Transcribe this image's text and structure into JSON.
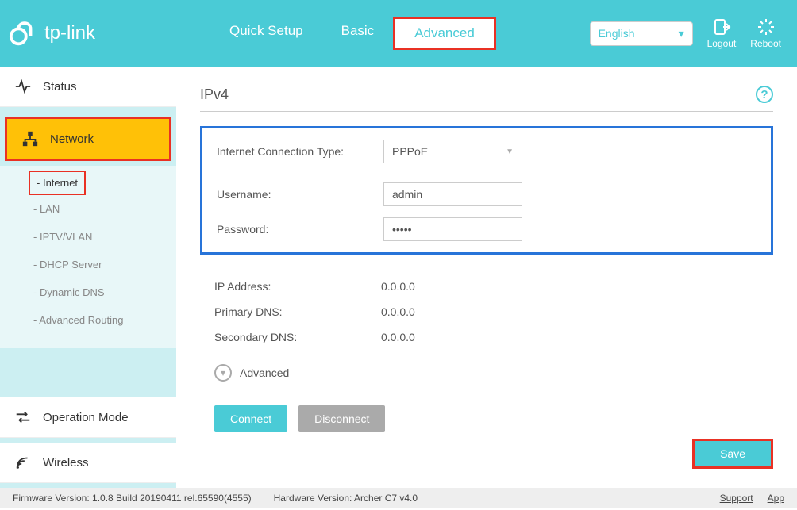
{
  "header": {
    "brand": "tp-link",
    "tabs": {
      "quick_setup": "Quick Setup",
      "basic": "Basic",
      "advanced": "Advanced"
    },
    "language": "English",
    "logout": "Logout",
    "reboot": "Reboot"
  },
  "sidebar": {
    "status": "Status",
    "network": "Network",
    "sub": {
      "internet": "Internet",
      "lan": "LAN",
      "iptv": "IPTV/VLAN",
      "dhcp": "DHCP Server",
      "ddns": "Dynamic DNS",
      "routing": "Advanced Routing"
    },
    "operation_mode": "Operation Mode",
    "wireless": "Wireless"
  },
  "main": {
    "title": "IPv4",
    "labels": {
      "conn_type": "Internet Connection Type:",
      "username": "Username:",
      "password": "Password:",
      "ip": "IP Address:",
      "pdns": "Primary DNS:",
      "sdns": "Secondary DNS:"
    },
    "values": {
      "conn_type": "PPPoE",
      "username": "admin",
      "password": "•••••",
      "ip": "0.0.0.0",
      "pdns": "0.0.0.0",
      "sdns": "0.0.0.0"
    },
    "advanced_toggle": "Advanced",
    "buttons": {
      "connect": "Connect",
      "disconnect": "Disconnect",
      "save": "Save"
    }
  },
  "footer": {
    "firmware": "Firmware Version: 1.0.8 Build 20190411 rel.65590(4555)",
    "hardware": "Hardware Version: Archer C7 v4.0",
    "support": "Support",
    "app": "App"
  }
}
